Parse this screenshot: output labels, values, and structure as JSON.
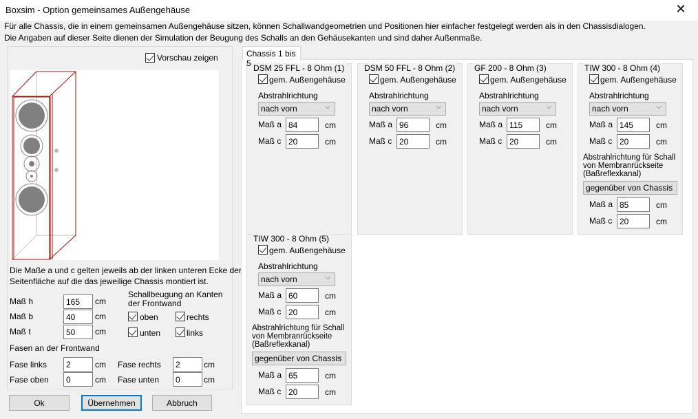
{
  "window": {
    "title": "Boxsim - Option gemeinsames Außengehäuse",
    "close": "✕"
  },
  "intro": [
    "Für alle Chassis, die in einem gemeinsamen Außengehäuse sitzen, können Schallwandgeometrien und Positionen hier einfacher festgelegt werden als in den Chassisdialogen.",
    "Die Angaben auf dieser Seite dienen der Simulation der  Beugung des Schalls an den Gehäusekanten und sind daher Außenmaße."
  ],
  "left": {
    "preview_label": "Vorschau zeigen",
    "note": [
      "Die Maße a und c gelten jeweils ab der linken unteren Ecke der",
      "Seitenfläche auf die das jeweilige Chassis montiert ist."
    ],
    "dims": [
      {
        "label": "Maß h",
        "value": "165",
        "unit": "cm"
      },
      {
        "label": "Maß b",
        "value": "40",
        "unit": "cm"
      },
      {
        "label": "Maß t",
        "value": "50",
        "unit": "cm"
      }
    ],
    "diffraction_label": [
      "Schallbeugung an Kanten",
      "der Frontwand"
    ],
    "edges": {
      "oben": "oben",
      "rechts": "rechts",
      "unten": "unten",
      "links": "links"
    },
    "chamfer_label": "Fasen an der Frontwand",
    "chamfers": [
      {
        "label": "Fase links",
        "value": "2",
        "unit": "cm"
      },
      {
        "label": "Fase rechts",
        "value": "2",
        "unit": "cm"
      },
      {
        "label": "Fase oben",
        "value": "0",
        "unit": "cm"
      },
      {
        "label": "Fase unten",
        "value": "0",
        "unit": "cm"
      }
    ]
  },
  "buttons": {
    "ok": "Ok",
    "apply": "Übernehmen",
    "cancel": "Abbruch"
  },
  "tab": "Chassis 1 bis 5",
  "common": {
    "checkbox": "gem. Außengehäuse",
    "direction": "Abstrahlrichtung",
    "a": "Maß a",
    "c": "Maß c",
    "unit": "cm",
    "rear_label": [
      "Abstrahlrichtung für Schall",
      "von Membranrückseite",
      "(Baßreflexkanal)"
    ]
  },
  "chassis": [
    {
      "title": "DSM 25 FFL - 8 Ohm (1)",
      "direction": "nach vorn",
      "a": "84",
      "c": "20"
    },
    {
      "title": "DSM 50 FFL - 8 Ohm (2)",
      "direction": "nach vorn",
      "a": "96",
      "c": "20"
    },
    {
      "title": "GF 200 - 8 Ohm (3)",
      "direction": "nach vorn",
      "a": "115",
      "c": "20"
    },
    {
      "title": "TIW 300 - 8 Ohm (4)",
      "direction": "nach vorn",
      "a": "145",
      "c": "20",
      "rear": {
        "direction": "gegenüber von Chassis",
        "a": "85",
        "c": "20"
      }
    },
    {
      "title": "TIW 300 - 8 Ohm (5)",
      "direction": "nach vorn",
      "a": "60",
      "c": "20",
      "rear": {
        "direction": "gegenüber von Chassis",
        "a": "65",
        "c": "20"
      }
    }
  ]
}
